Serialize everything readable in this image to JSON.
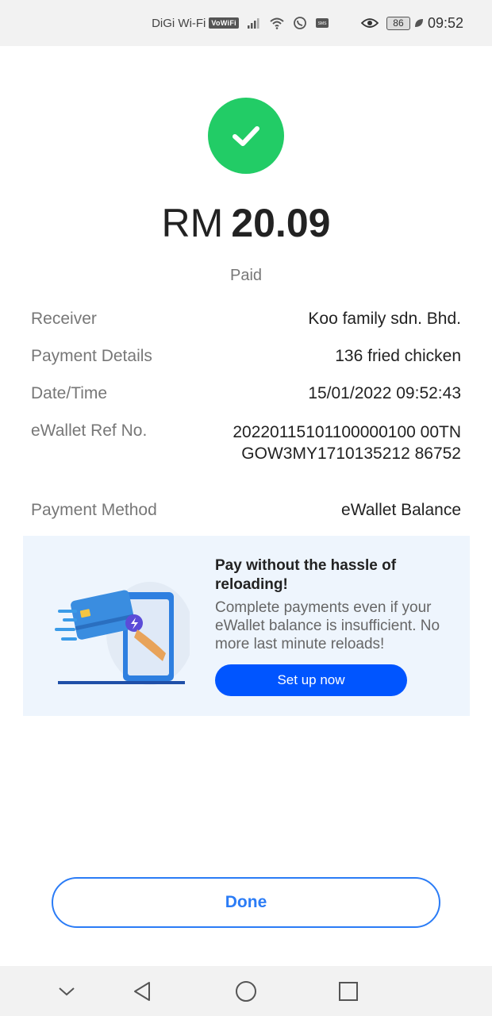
{
  "status_bar": {
    "carrier": "DiGi Wi-Fi",
    "vowifi": "VoWiFi",
    "battery": "86",
    "time": "09:52"
  },
  "payment": {
    "currency": "RM",
    "amount": "20.09",
    "status": "Paid"
  },
  "details": [
    {
      "label": "Receiver",
      "value": "Koo family sdn. Bhd."
    },
    {
      "label": "Payment Details",
      "value": "136 fried chicken"
    },
    {
      "label": "Date/Time",
      "value": "15/01/2022 09:52:43"
    },
    {
      "label": "eWallet Ref No.",
      "value": "20220115101100000100 00TNGOW3MY1710135212 86752"
    },
    {
      "label": "Payment Method",
      "value": "eWallet Balance"
    }
  ],
  "promo": {
    "title": "Pay without the hassle of reloading!",
    "description": "Complete payments even if your eWallet balance is insufficient. No more last minute reloads!",
    "button_label": "Set up now"
  },
  "done_label": "Done",
  "colors": {
    "success": "#22cc66",
    "primary": "#0055ff",
    "outline": "#2b7cf6"
  },
  "icons": {
    "status": [
      "signal-icon",
      "wifi-icon",
      "whatsapp-icon",
      "sms-icon",
      "eye-icon",
      "leaf-icon"
    ],
    "nav": [
      "chevron-down-icon",
      "back-triangle-icon",
      "home-circle-icon",
      "recents-square-icon"
    ]
  }
}
